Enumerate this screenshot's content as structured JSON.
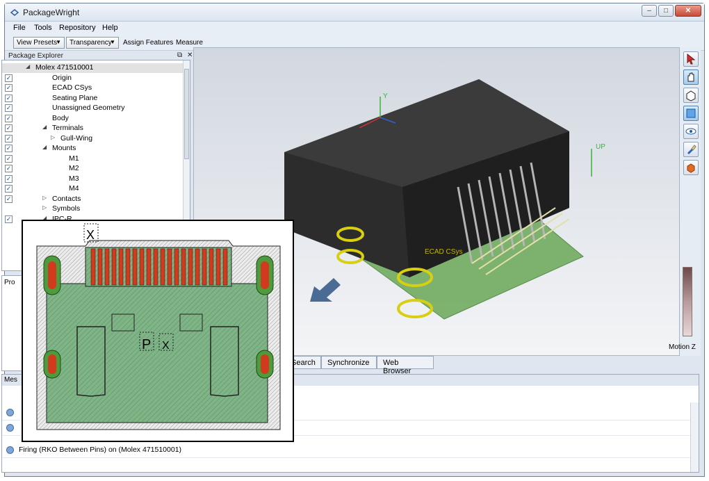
{
  "window": {
    "title": "PackageWright",
    "minimize": "–",
    "maximize": "□",
    "close": "✕"
  },
  "menu": {
    "items": [
      "File",
      "Tools",
      "Repository",
      "Help"
    ]
  },
  "toolbar": {
    "view_presets": "View Presets",
    "transparency": "Transparency",
    "assign_features": "Assign Features",
    "measure": "Measure"
  },
  "explorer": {
    "title": "Package Explorer",
    "ctrl_float": "⧉",
    "ctrl_close": "✕",
    "items": [
      {
        "label": "Molex 471510001",
        "indent": 2,
        "expander": "◢",
        "checked": null
      },
      {
        "label": "Origin",
        "indent": 4,
        "expander": "",
        "checked": true
      },
      {
        "label": "ECAD CSys",
        "indent": 4,
        "expander": "",
        "checked": true
      },
      {
        "label": "Seating Plane",
        "indent": 4,
        "expander": "",
        "checked": true
      },
      {
        "label": "Unassigned Geometry",
        "indent": 4,
        "expander": "",
        "checked": true
      },
      {
        "label": "Body",
        "indent": 4,
        "expander": "",
        "checked": true
      },
      {
        "label": "Terminals",
        "indent": 4,
        "expander": "◢",
        "checked": true
      },
      {
        "label": "Gull-Wing",
        "indent": 5,
        "expander": "▷",
        "checked": true
      },
      {
        "label": "Mounts",
        "indent": 4,
        "expander": "◢",
        "checked": true
      },
      {
        "label": "M1",
        "indent": 6,
        "expander": "",
        "checked": true
      },
      {
        "label": "M2",
        "indent": 6,
        "expander": "",
        "checked": true
      },
      {
        "label": "M3",
        "indent": 6,
        "expander": "",
        "checked": true
      },
      {
        "label": "M4",
        "indent": 6,
        "expander": "",
        "checked": true
      },
      {
        "label": "Contacts",
        "indent": 4,
        "expander": "▷",
        "checked": true
      },
      {
        "label": "Symbols",
        "indent": 4,
        "expander": "▷",
        "checked": null
      },
      {
        "label": "IPC-R",
        "indent": 4,
        "expander": "◢",
        "checked": true
      }
    ]
  },
  "properties": {
    "title": "Pro"
  },
  "viewport": {
    "axis_y": "Y",
    "axis_up": "UP",
    "ecad_label": "ECAD CSys",
    "motion_label": "Motion Z"
  },
  "tabs": [
    "Search",
    "Synchronize",
    "Web Browser"
  ],
  "messages": {
    "title": "Mes",
    "rows": [
      "",
      "",
      "Firing (RKO Between Pins) on (Molex 471510001)"
    ]
  },
  "inset": {
    "label_p": "P",
    "label_x": "X"
  },
  "colors": {
    "pcb_green": "#4e9a3c",
    "pad_red": "#d23a1e",
    "body_black": "#2a2a2a",
    "accent_blue": "#3d6fb0"
  }
}
